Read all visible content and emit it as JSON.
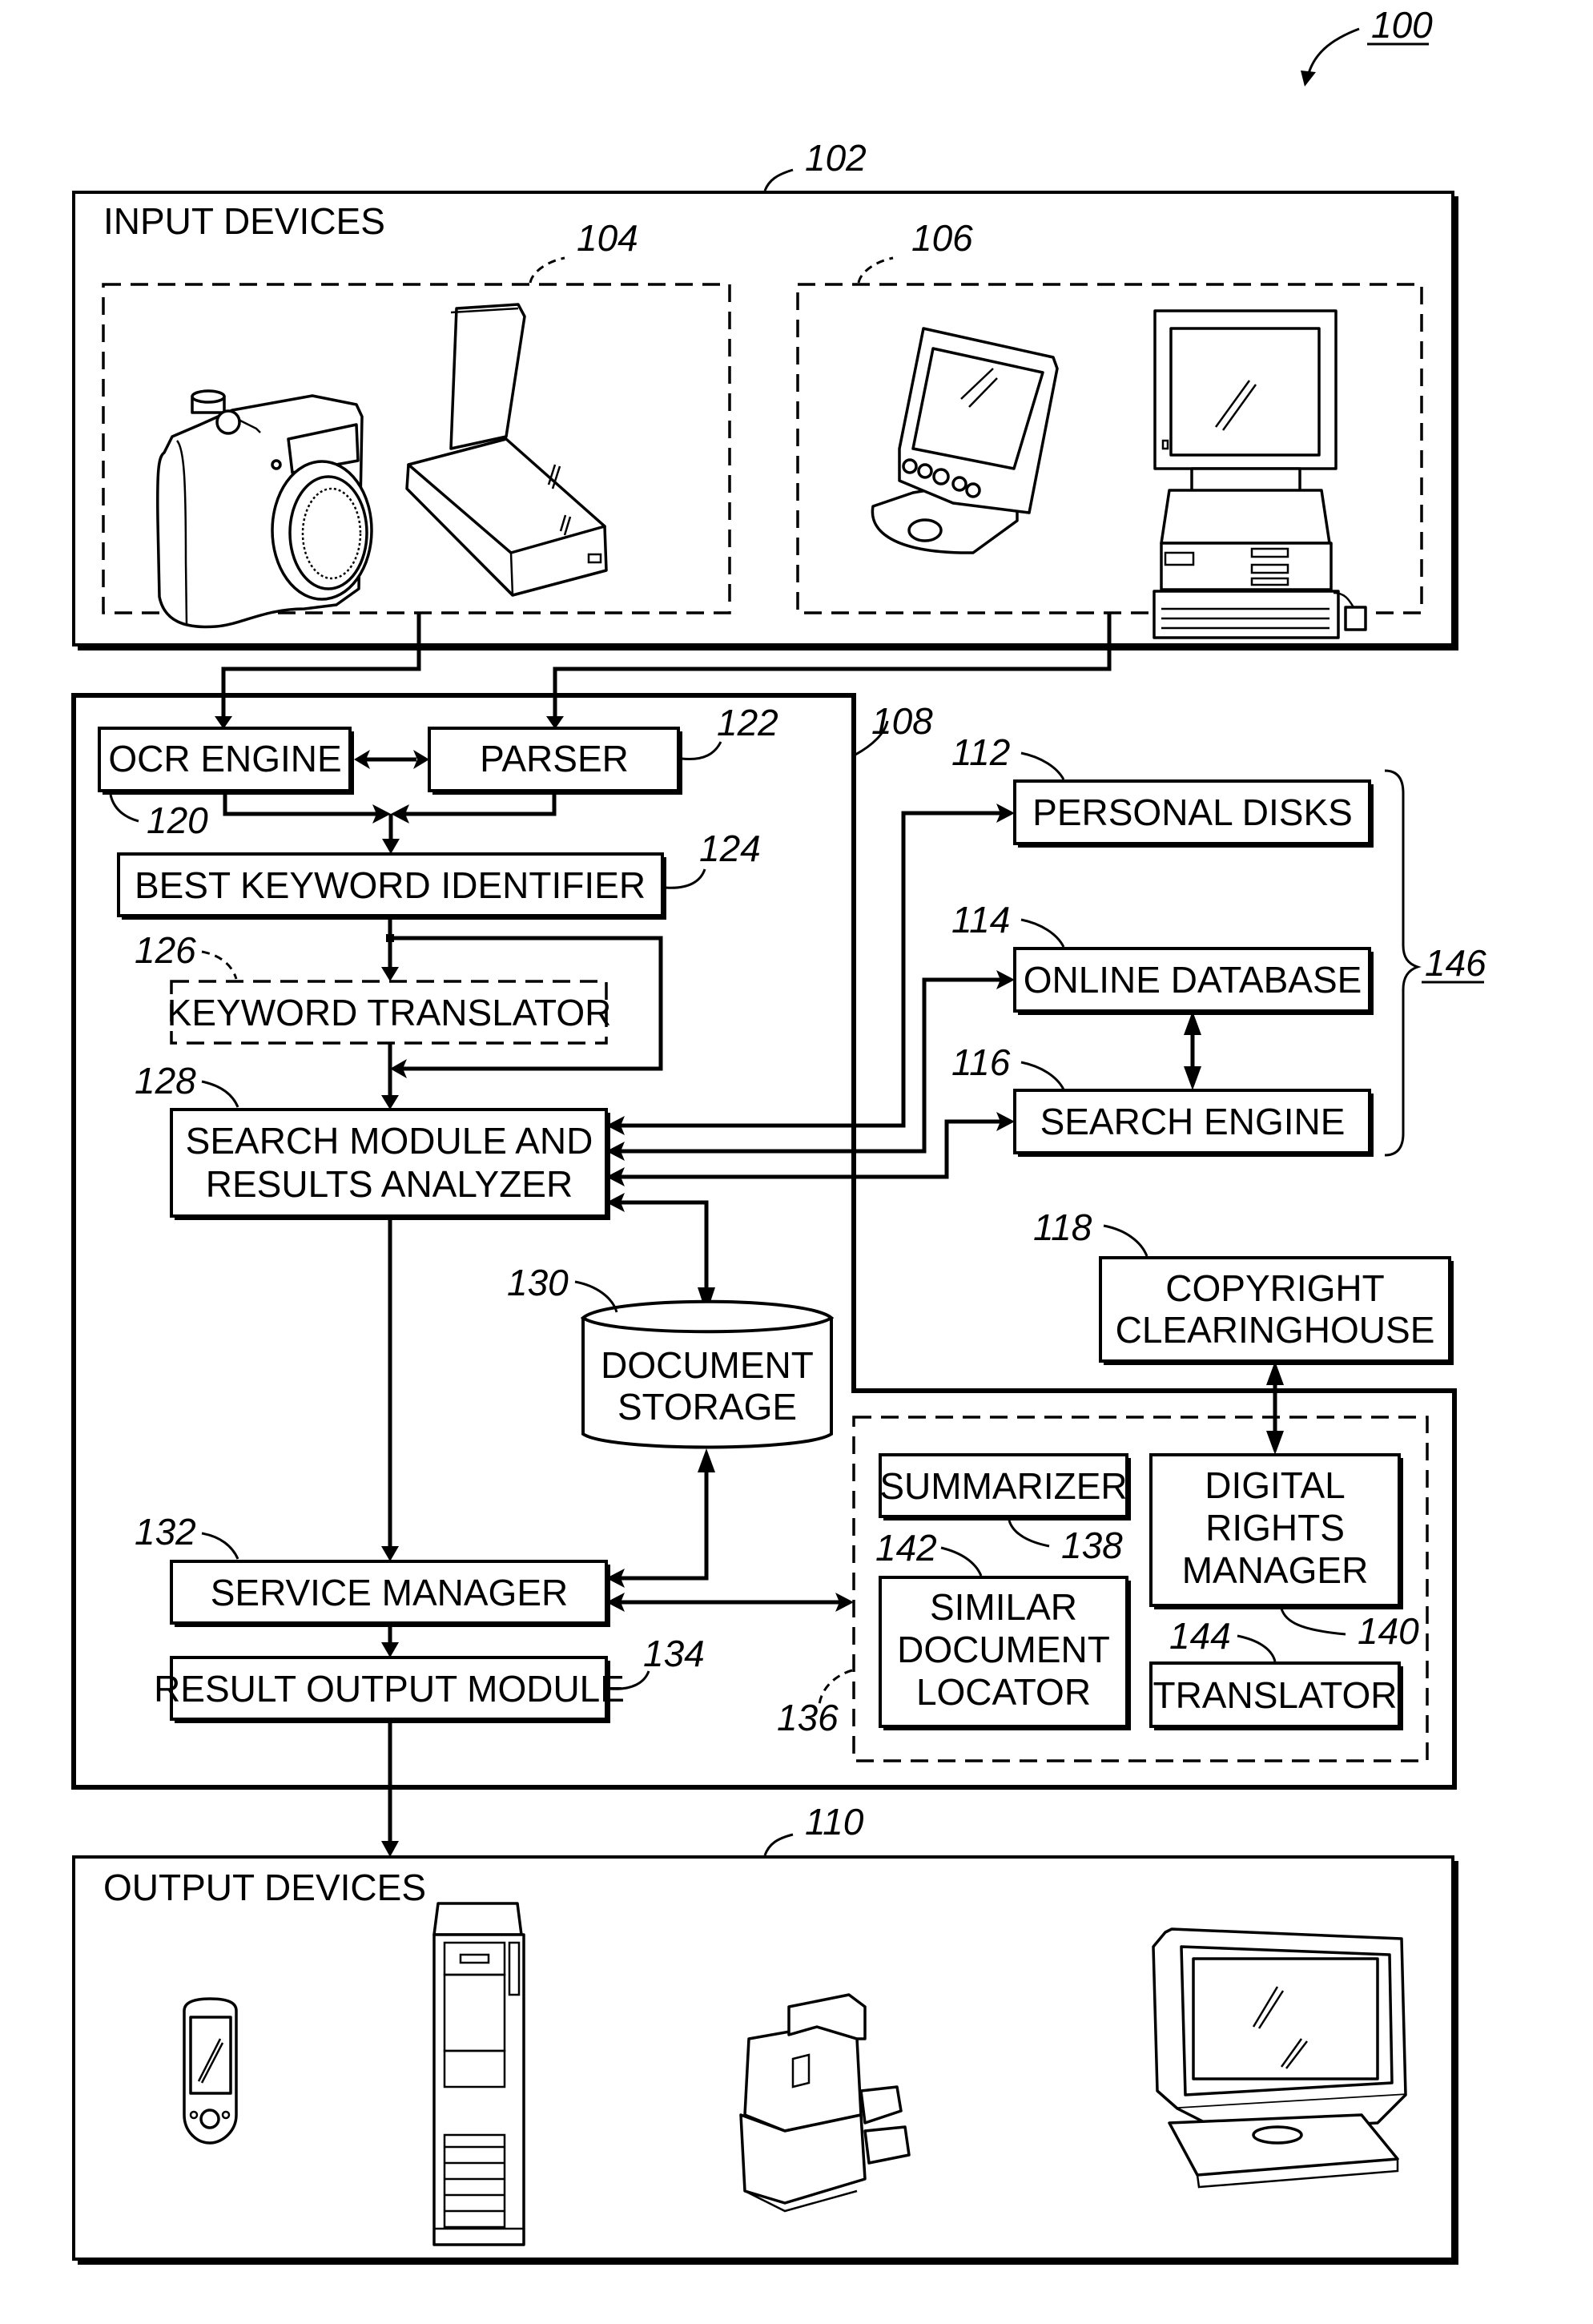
{
  "figure": {
    "ref": "100",
    "input_devices": {
      "ref": "102",
      "title": "INPUT DEVICES",
      "groups": [
        {
          "ref": "104",
          "devices": [
            "camera-icon",
            "scanner-icon"
          ]
        },
        {
          "ref": "106",
          "devices": [
            "pda-icon",
            "desktop-computer-icon"
          ]
        }
      ]
    },
    "processing_system": {
      "ref": "108",
      "modules": {
        "ocr": {
          "ref": "120",
          "label": "OCR ENGINE"
        },
        "parser": {
          "ref": "122",
          "label": "PARSER"
        },
        "best_keyword": {
          "ref": "124",
          "label": "BEST KEYWORD IDENTIFIER"
        },
        "keyword_translator": {
          "ref": "126",
          "label": "KEYWORD TRANSLATOR"
        },
        "search_module": {
          "ref": "128",
          "label_lines": [
            "SEARCH MODULE AND",
            "RESULTS ANALYZER"
          ]
        },
        "document_storage": {
          "ref": "130",
          "label_lines": [
            "DOCUMENT",
            "STORAGE"
          ]
        },
        "service_manager": {
          "ref": "132",
          "label": "SERVICE MANAGER"
        },
        "result_output": {
          "ref": "134",
          "label": "RESULT OUTPUT MODULE"
        }
      },
      "services": {
        "ref": "136",
        "summarizer": {
          "ref": "138",
          "label": "SUMMARIZER"
        },
        "digital_rights": {
          "ref": "140",
          "label_lines": [
            "DIGITAL",
            "RIGHTS",
            "MANAGER"
          ]
        },
        "similar_doc": {
          "ref": "142",
          "label_lines": [
            "SIMILAR",
            "DOCUMENT",
            "LOCATOR"
          ]
        },
        "translator": {
          "ref": "144",
          "label": "TRANSLATOR"
        }
      }
    },
    "external_sources": {
      "ref": "146",
      "personal_disks": {
        "ref": "112",
        "label": "PERSONAL DISKS"
      },
      "online_database": {
        "ref": "114",
        "label": "ONLINE DATABASE"
      },
      "search_engine": {
        "ref": "116",
        "label": "SEARCH ENGINE"
      }
    },
    "copyright": {
      "ref": "118",
      "label_lines": [
        "COPYRIGHT",
        "CLEARINGHOUSE"
      ]
    },
    "output_devices": {
      "ref": "110",
      "title": "OUTPUT DEVICES",
      "devices": [
        "pda-icon",
        "tower-server-icon",
        "printer-copier-icon",
        "monitor-icon"
      ]
    }
  }
}
